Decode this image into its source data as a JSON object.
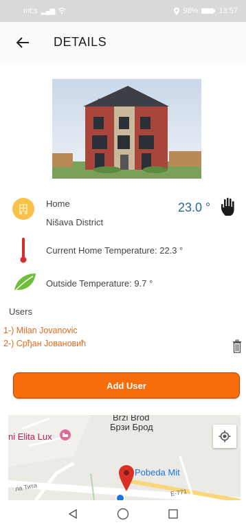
{
  "status_bar": {
    "carrier": "mt:s",
    "battery": "98%",
    "time": "13:57"
  },
  "header": {
    "title": "DETAILS"
  },
  "home": {
    "name": "Home",
    "district": "Nišava District",
    "setpoint": "23.0 °"
  },
  "readings": {
    "current_temp": "Current Home Temperature: 22.3 °",
    "outside_temp": "Outside Temperature: 9.7 °"
  },
  "users": {
    "heading": "Users",
    "items": [
      "1-) Milan Jovanovic",
      "2-) Срђан Јовановић"
    ]
  },
  "actions": {
    "add_user": "Add User"
  },
  "map": {
    "place_latin": "Brzi Brod",
    "place_cyrillic": "Брзи Брод",
    "poi_left": "ni Elita Lux",
    "poi_marker": "Pobeda Mit",
    "road_e771": "E-771",
    "road_tita": "ла Тита"
  },
  "icons": {
    "back": "arrow-left-icon",
    "home": "house-icon",
    "hand": "hand-icon",
    "thermometer": "thermometer-icon",
    "leaf": "leaf-icon",
    "trash": "trash-icon",
    "locate": "my-location-icon"
  },
  "colors": {
    "accent": "#f76c0b",
    "user_text": "#e56a1b",
    "setpoint_text": "#2f6690",
    "thermometer": "#d32f2f",
    "leaf": "#6fbf3b"
  }
}
